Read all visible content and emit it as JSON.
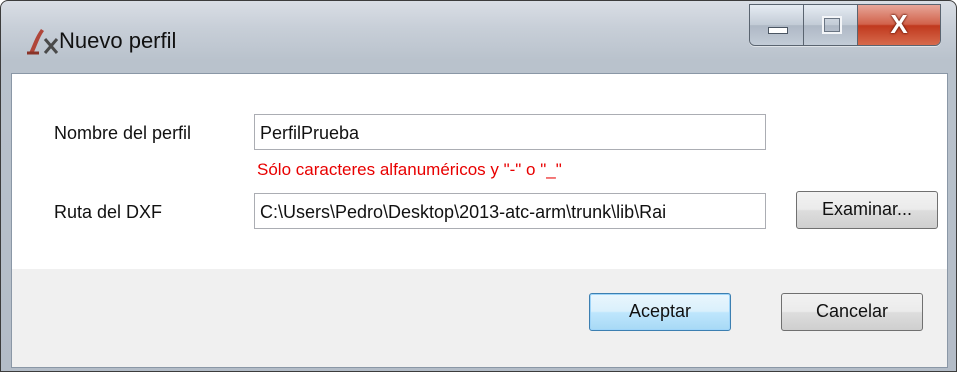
{
  "window": {
    "title": "Nuevo perfil",
    "icon": "profile-app-icon"
  },
  "caption_buttons": {
    "minimize_icon": "minimize-icon",
    "maximize_icon": "maximize-icon",
    "close_glyph": "X"
  },
  "form": {
    "profile_name_label": "Nombre del perfil",
    "profile_name_value": "PerfilPrueba",
    "validation_message": "Sólo caracteres alfanuméricos y \"-\" o \"_\"",
    "dxf_path_label": "Ruta del DXF",
    "dxf_path_value": "C:\\Users\\Pedro\\Desktop\\2013-atc-arm\\trunk\\lib\\Rai",
    "browse_button_label": "Examinar..."
  },
  "footer": {
    "accept_label": "Aceptar",
    "cancel_label": "Cancelar"
  },
  "colors": {
    "error": "#e80000",
    "default_button_border": "#3c7fb1",
    "close_button": "#c0391e"
  }
}
